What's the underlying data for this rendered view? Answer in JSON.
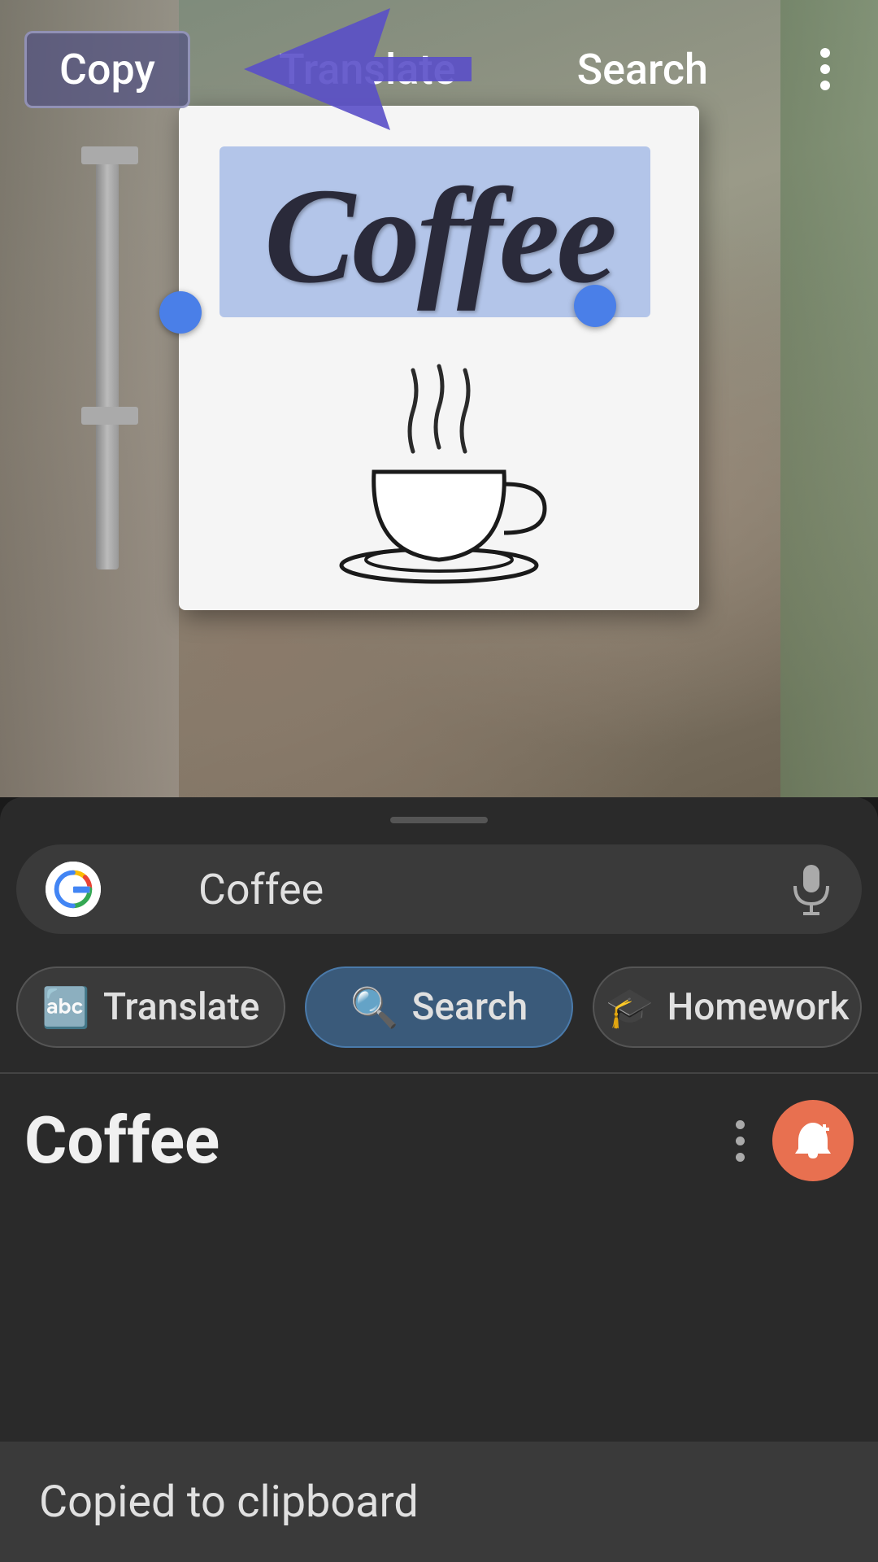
{
  "toolbar": {
    "copy_label": "Copy",
    "translate_label": "Translate",
    "search_label": "Search"
  },
  "image": {
    "text_recognized": "Coffee"
  },
  "bottom_panel": {
    "search_query": "Coffee",
    "mic_icon": "microphone-icon",
    "buttons": [
      {
        "id": "translate",
        "label": "Translate",
        "icon": "🔤"
      },
      {
        "id": "search",
        "label": "Search",
        "icon": "🔍"
      },
      {
        "id": "homework",
        "label": "Homework",
        "icon": "🎓"
      }
    ],
    "result_title": "Coffee",
    "toast_text": "Copied to clipboard"
  }
}
